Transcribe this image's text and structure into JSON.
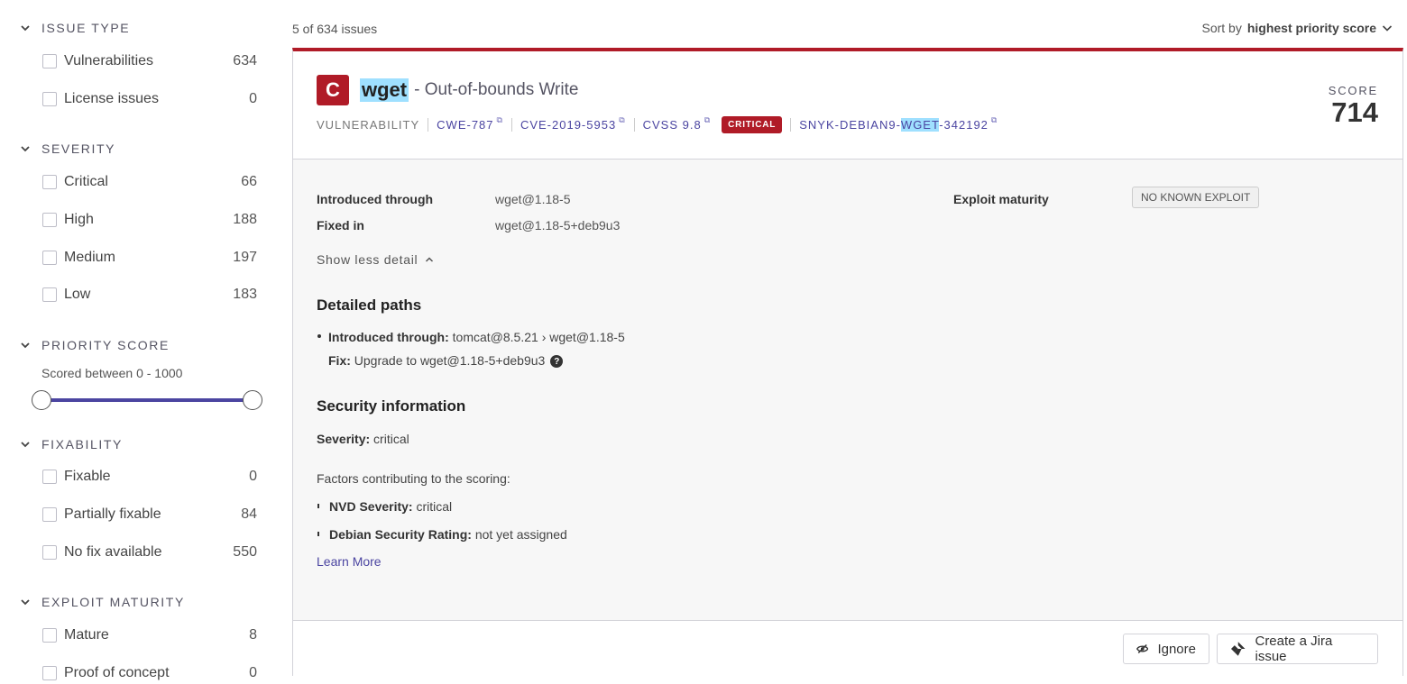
{
  "sidebar": {
    "issue_type": {
      "title": "ISSUE TYPE",
      "items": [
        {
          "label": "Vulnerabilities",
          "count": "634"
        },
        {
          "label": "License issues",
          "count": "0"
        }
      ]
    },
    "severity": {
      "title": "SEVERITY",
      "items": [
        {
          "label": "Critical",
          "count": "66"
        },
        {
          "label": "High",
          "count": "188"
        },
        {
          "label": "Medium",
          "count": "197"
        },
        {
          "label": "Low",
          "count": "183"
        }
      ]
    },
    "priority_score": {
      "title": "PRIORITY SCORE",
      "scored_text": "Scored between 0 - 1000",
      "min": 0,
      "max": 1000
    },
    "fixability": {
      "title": "FIXABILITY",
      "items": [
        {
          "label": "Fixable",
          "count": "0"
        },
        {
          "label": "Partially fixable",
          "count": "84"
        },
        {
          "label": "No fix available",
          "count": "550"
        }
      ]
    },
    "exploit_maturity": {
      "title": "EXPLOIT MATURITY",
      "items": [
        {
          "label": "Mature",
          "count": "8"
        },
        {
          "label": "Proof of concept",
          "count": "0"
        }
      ]
    }
  },
  "main": {
    "count_text": "5 of 634 issues",
    "sort_prefix": "Sort by",
    "sort_value": "highest priority score"
  },
  "issue": {
    "severity_letter": "C",
    "package": "wget",
    "title_rest": "- Out-of-bounds Write",
    "meta_type": "VULNERABILITY",
    "cwe": "CWE-787",
    "cve": "CVE-2019-5953",
    "cvss": "CVSS 9.8",
    "severity_badge": "CRITICAL",
    "snyk_id_prefix": "SNYK-DEBIAN9-",
    "snyk_id_highlight": "WGET",
    "snyk_id_suffix": "-342192",
    "score_label": "SCORE",
    "score": "714",
    "introduced_through_label": "Introduced through",
    "introduced_through": "wget@1.18-5",
    "fixed_in_label": "Fixed in",
    "fixed_in": "wget@1.18-5+deb9u3",
    "exploit_maturity_label": "Exploit maturity",
    "exploit_maturity": "NO KNOWN EXPLOIT",
    "toggle_label": "Show less detail",
    "detailed_paths_heading": "Detailed paths",
    "path_intro_label": "Introduced through:",
    "path_intro_value": "tomcat@8.5.21 › wget@1.18-5",
    "path_fix_label": "Fix:",
    "path_fix_value": "Upgrade to wget@1.18-5+deb9u3",
    "security_info_heading": "Security information",
    "severity_label": "Severity:",
    "severity_value": "critical",
    "factors_text": "Factors contributing to the scoring:",
    "factor1_label": "NVD Severity:",
    "factor1_value": "critical",
    "factor2_label": "Debian Security Rating:",
    "factor2_value": "not yet assigned",
    "learn_more": "Learn More",
    "ignore_label": "Ignore",
    "jira_label": "Create a Jira issue"
  },
  "colors": {
    "critical": "#b01b27",
    "accent": "#4b45a1",
    "highlight": "#9fe0ff"
  }
}
